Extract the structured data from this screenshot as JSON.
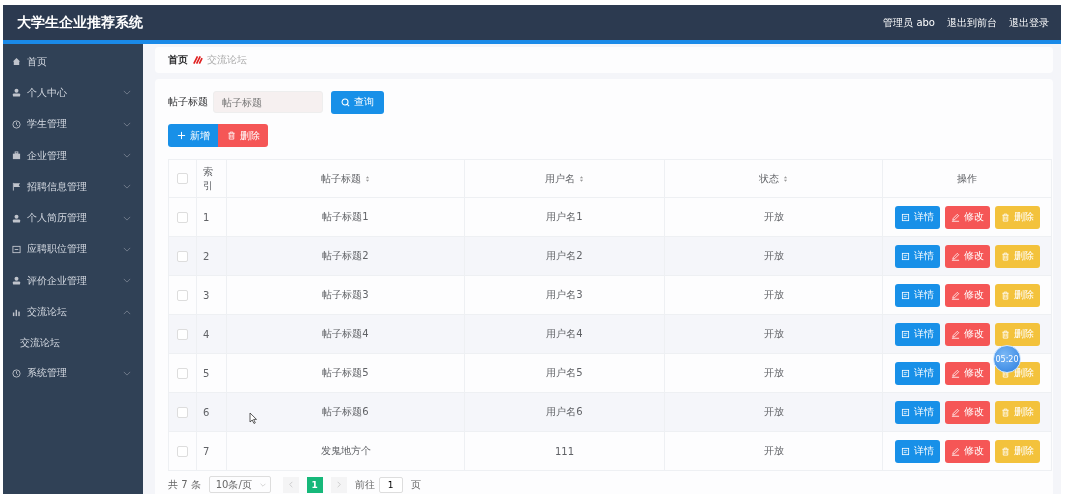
{
  "header": {
    "title": "大学生企业推荐系统",
    "user": "管理员 abo",
    "links": [
      "退出到前台",
      "退出登录"
    ]
  },
  "sidebar": {
    "items": [
      {
        "label": "首页",
        "kind": "link"
      },
      {
        "label": "个人中心",
        "kind": "menu",
        "expanded": false
      },
      {
        "label": "学生管理",
        "kind": "menu",
        "expanded": false
      },
      {
        "label": "企业管理",
        "kind": "menu",
        "expanded": false
      },
      {
        "label": "招聘信息管理",
        "kind": "menu",
        "expanded": false
      },
      {
        "label": "个人简历管理",
        "kind": "menu",
        "expanded": false
      },
      {
        "label": "应聘职位管理",
        "kind": "menu",
        "expanded": false
      },
      {
        "label": "评价企业管理",
        "kind": "menu",
        "expanded": false
      },
      {
        "label": "交流论坛",
        "kind": "menu",
        "expanded": true,
        "children": [
          {
            "label": "交流论坛"
          }
        ]
      },
      {
        "label": "系统管理",
        "kind": "menu",
        "expanded": false
      }
    ]
  },
  "breadcrumb": [
    "首页",
    "交流论坛"
  ],
  "search": {
    "label": "帖子标题",
    "placeholder": "帖子标题",
    "button": "查询"
  },
  "actions": [
    "新增",
    "删除"
  ],
  "table": {
    "columns": [
      {
        "label": "索引",
        "sortable": false
      },
      {
        "label": "帖子标题",
        "sortable": true
      },
      {
        "label": "用户名",
        "sortable": true
      },
      {
        "label": "状态",
        "sortable": true
      },
      {
        "label": "操作",
        "sortable": false
      }
    ],
    "all_checked": false,
    "rows": [
      {
        "index": "1",
        "title": "帖子标题1",
        "user": "用户名1",
        "status": "开放",
        "checked": false,
        "buttons": [
          "详情",
          "修改",
          "删除"
        ]
      },
      {
        "index": "2",
        "title": "帖子标题2",
        "user": "用户名2",
        "status": "开放",
        "checked": false,
        "buttons": [
          "详情",
          "修改",
          "删除"
        ]
      },
      {
        "index": "3",
        "title": "帖子标题3",
        "user": "用户名3",
        "status": "开放",
        "checked": false,
        "buttons": [
          "详情",
          "修改",
          "删除"
        ]
      },
      {
        "index": "4",
        "title": "帖子标题4",
        "user": "用户名4",
        "status": "开放",
        "checked": false,
        "buttons": [
          "详情",
          "修改",
          "删除"
        ]
      },
      {
        "index": "5",
        "title": "帖子标题5",
        "user": "用户名5",
        "status": "开放",
        "checked": false,
        "buttons": [
          "详情",
          "修改",
          "删除"
        ]
      },
      {
        "index": "6",
        "title": "帖子标题6",
        "user": "用户名6",
        "status": "开放",
        "checked": false,
        "buttons": [
          "详情",
          "修改",
          "删除"
        ]
      },
      {
        "index": "7",
        "title": "发鬼地方个",
        "user": "111",
        "status": "开放",
        "checked": false,
        "buttons": [
          "详情",
          "修改",
          "删除"
        ]
      }
    ]
  },
  "pagination": {
    "total": "共 7 条",
    "page_size": "10条/页",
    "pages": [
      {
        "label": "1",
        "selected": true
      }
    ],
    "goto_label": "前往",
    "goto_value": "1",
    "goto_suffix": "页"
  },
  "timer": "05:20"
}
